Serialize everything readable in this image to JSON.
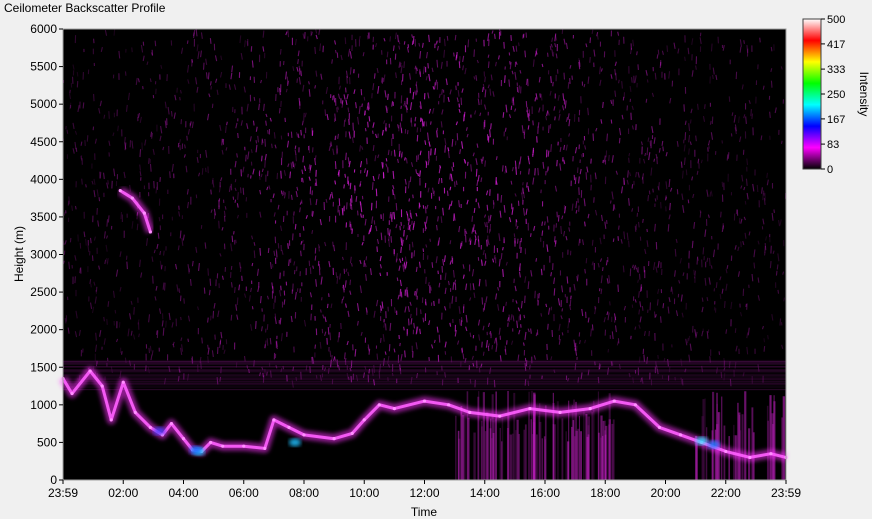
{
  "window": {
    "title": "Ceilometer Backscatter Profile"
  },
  "chart_data": {
    "type": "heatmap",
    "title": "Ceilometer Backscatter Profile",
    "xlabel": "Time",
    "ylabel": "Height (m)",
    "x_ticks": [
      "23:59",
      "02:00",
      "04:00",
      "06:00",
      "08:00",
      "10:00",
      "12:00",
      "14:00",
      "16:00",
      "18:00",
      "20:00",
      "22:00",
      "23:59"
    ],
    "y_ticks": [
      0,
      500,
      1000,
      1500,
      2000,
      2500,
      3000,
      3500,
      4000,
      4500,
      5000,
      5500,
      6000
    ],
    "ylim": [
      0,
      6000
    ],
    "colorbar": {
      "label": "Intensity",
      "ticks": [
        0,
        83,
        167,
        250,
        333,
        417,
        500
      ],
      "range": [
        0,
        500
      ],
      "colors": [
        "#000000",
        "#ff00ff",
        "#0000ff",
        "#00ffff",
        "#00ff00",
        "#ffff00",
        "#ff0000",
        "#ffffff"
      ]
    },
    "layers": [
      {
        "name": "cloud-base-layer",
        "points": [
          [
            0,
            1350
          ],
          [
            0.3,
            1150
          ],
          [
            0.9,
            1450
          ],
          [
            1.3,
            1250
          ],
          [
            1.6,
            800
          ],
          [
            2.0,
            1300
          ],
          [
            2.4,
            900
          ],
          [
            2.9,
            700
          ],
          [
            3.3,
            600
          ],
          [
            3.6,
            750
          ],
          [
            4.0,
            550
          ],
          [
            4.3,
            400
          ],
          [
            4.6,
            380
          ],
          [
            4.9,
            500
          ],
          [
            5.3,
            450
          ],
          [
            6.0,
            450
          ],
          [
            6.7,
            420
          ],
          [
            7.0,
            800
          ],
          [
            7.5,
            700
          ],
          [
            8.0,
            600
          ],
          [
            9.0,
            550
          ],
          [
            9.6,
            620
          ],
          [
            10.0,
            800
          ],
          [
            10.5,
            1000
          ],
          [
            11.0,
            950
          ],
          [
            12.0,
            1050
          ],
          [
            12.8,
            1000
          ],
          [
            13.5,
            900
          ],
          [
            14.5,
            850
          ],
          [
            15.5,
            950
          ],
          [
            16.5,
            900
          ],
          [
            17.5,
            950
          ],
          [
            18.3,
            1050
          ],
          [
            19.0,
            1000
          ],
          [
            19.8,
            700
          ],
          [
            20.5,
            600
          ],
          [
            21.2,
            500
          ],
          [
            22.0,
            380
          ],
          [
            22.8,
            300
          ],
          [
            23.5,
            350
          ],
          [
            24.0,
            300
          ]
        ]
      },
      {
        "name": "upper-feature",
        "points": [
          [
            1.9,
            3850
          ],
          [
            2.3,
            3750
          ],
          [
            2.7,
            3550
          ],
          [
            2.9,
            3300
          ]
        ]
      }
    ]
  }
}
